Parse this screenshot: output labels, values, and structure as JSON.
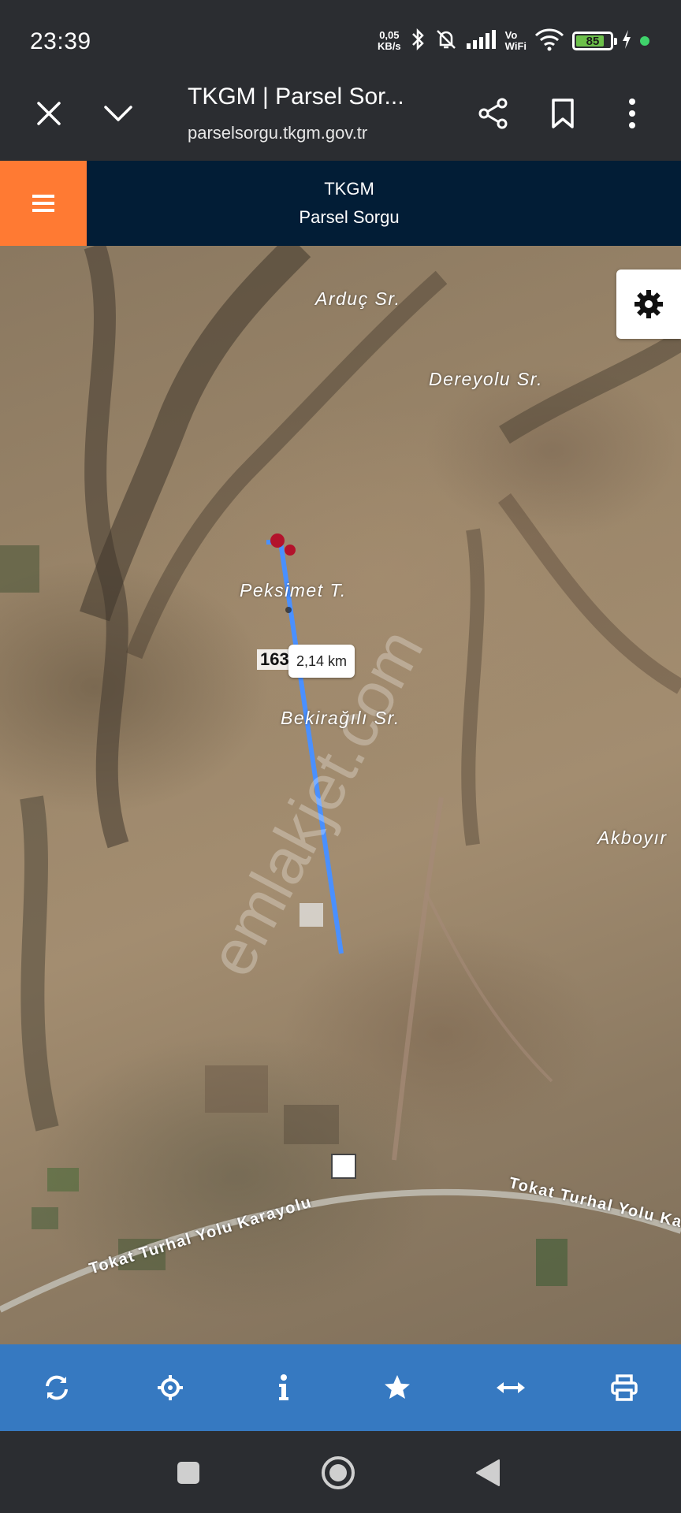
{
  "status_bar": {
    "time": "23:39",
    "net_speed_value": "0,05",
    "net_speed_unit": "KB/s",
    "vowifi_top": "Vo",
    "vowifi_bottom": "WiFi",
    "battery_level": "85",
    "battery_percent": 85
  },
  "browser": {
    "page_title": "TKGM | Parsel Sor...",
    "url": "parselsorgu.tkgm.gov.tr"
  },
  "app_header": {
    "brand_line1": "TKGM",
    "brand_line2": "Parsel Sorgu",
    "accent_color": "#ff7a33",
    "header_color": "#021d36"
  },
  "map": {
    "place_labels": {
      "arduc": "Arduç Sr.",
      "dereyolu": "Dereyolu Sr.",
      "peksimet": "Peksimet T.",
      "bekiragili": "Bekirağılı Sr.",
      "akboyir": "Akboyır"
    },
    "road_labels": {
      "left": "Tokat Turhal Yolu Karayolu",
      "right": "Tokat Turhal Yolu Kara"
    },
    "parcel_number": "163",
    "measure_distance": "2,14 km",
    "watermark": "emlakjet.com",
    "measure_line_color": "#4a90ff"
  },
  "toolbar": {
    "color": "#3679c1",
    "items": [
      "refresh-icon",
      "locate-icon",
      "info-icon",
      "star-icon",
      "measure-icon",
      "print-icon"
    ]
  }
}
